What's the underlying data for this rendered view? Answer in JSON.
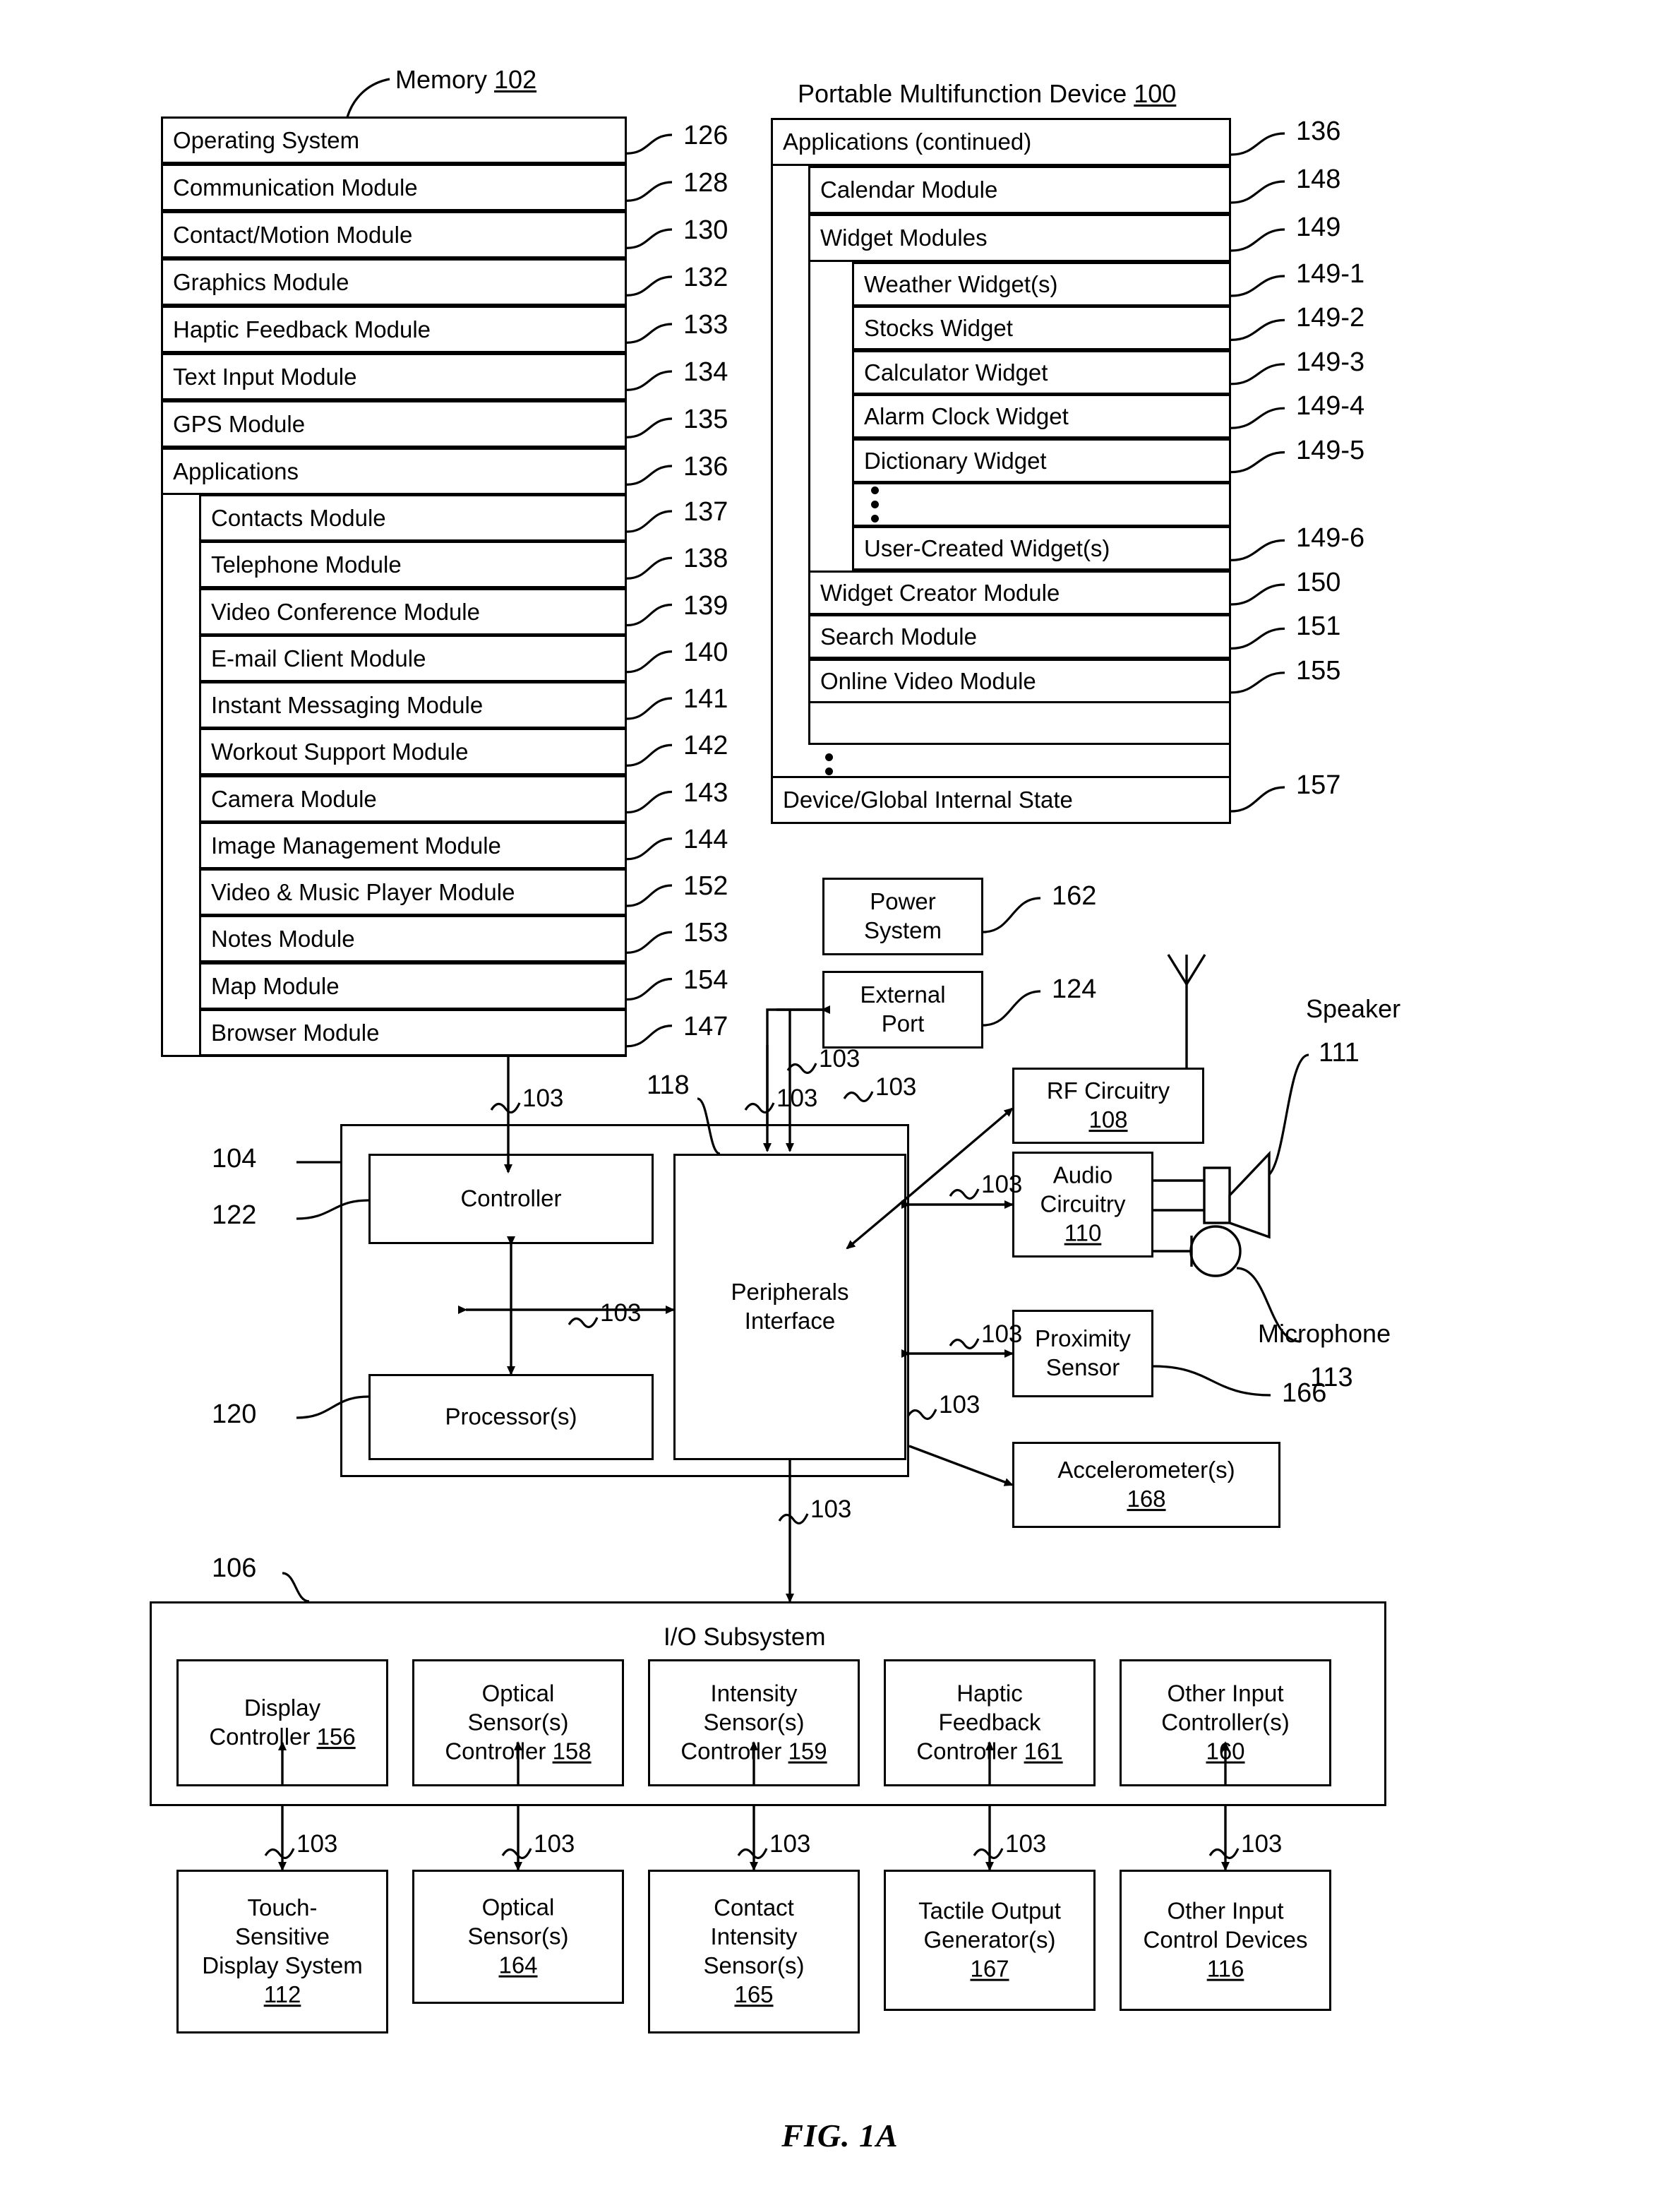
{
  "figure": {
    "caption": "FIG. 1A",
    "memory_title": "Memory",
    "memory_ref": "102",
    "device_title": "Portable Multifunction Device",
    "device_ref": "100"
  },
  "memory_block": {
    "rows": [
      {
        "label": "Operating System",
        "ref": "126"
      },
      {
        "label": "Communication Module",
        "ref": "128"
      },
      {
        "label": "Contact/Motion Module",
        "ref": "130"
      },
      {
        "label": "Graphics Module",
        "ref": "132"
      },
      {
        "label": "Haptic Feedback Module",
        "ref": "133"
      },
      {
        "label": "Text Input Module",
        "ref": "134"
      },
      {
        "label": "GPS Module",
        "ref": "135"
      },
      {
        "label": "Applications",
        "ref": "136"
      }
    ],
    "applications": [
      {
        "label": "Contacts Module",
        "ref": "137"
      },
      {
        "label": "Telephone Module",
        "ref": "138"
      },
      {
        "label": "Video Conference Module",
        "ref": "139"
      },
      {
        "label": "E-mail Client Module",
        "ref": "140"
      },
      {
        "label": "Instant Messaging Module",
        "ref": "141"
      },
      {
        "label": "Workout Support Module",
        "ref": "142"
      },
      {
        "label": "Camera Module",
        "ref": "143"
      },
      {
        "label": "Image Management Module",
        "ref": "144"
      },
      {
        "label": "Video & Music Player Module",
        "ref": "152"
      },
      {
        "label": "Notes Module",
        "ref": "153"
      },
      {
        "label": "Map Module",
        "ref": "154"
      },
      {
        "label": "Browser Module",
        "ref": "147"
      }
    ]
  },
  "device_block": {
    "header": {
      "label": "Applications (continued)",
      "ref": "136"
    },
    "calendar": {
      "label": "Calendar Module",
      "ref": "148"
    },
    "widget_modules": {
      "label": "Widget Modules",
      "ref": "149"
    },
    "widgets": [
      {
        "label": "Weather Widget(s)",
        "ref": "149-1"
      },
      {
        "label": "Stocks Widget",
        "ref": "149-2"
      },
      {
        "label": "Calculator Widget",
        "ref": "149-3"
      },
      {
        "label": "Alarm Clock Widget",
        "ref": "149-4"
      },
      {
        "label": "Dictionary Widget",
        "ref": "149-5"
      },
      {
        "label": "",
        "ref": ""
      },
      {
        "label": "User-Created Widget(s)",
        "ref": "149-6"
      }
    ],
    "tail": [
      {
        "label": "Widget Creator Module",
        "ref": "150"
      },
      {
        "label": "Search Module",
        "ref": "151"
      },
      {
        "label": "Online Video Module",
        "ref": "155"
      }
    ],
    "global_state": {
      "label": "Device/Global Internal State",
      "ref": "157"
    }
  },
  "peripherals": {
    "power_system": {
      "line1": "Power",
      "line2": "System",
      "ref": "162"
    },
    "external_port": {
      "line1": "External",
      "line2": "Port",
      "ref": "124"
    },
    "rf_circuitry": {
      "line1": "RF Circuitry",
      "ref": "108"
    },
    "audio_circuitry": {
      "line1": "Audio",
      "line2": "Circuitry",
      "ref": "110"
    },
    "proximity_sensor": {
      "line1": "Proximity",
      "line2": "Sensor",
      "ref": "166"
    },
    "accelerometers": {
      "line1": "Accelerometer(s)",
      "ref": "168"
    },
    "speaker": {
      "label": "Speaker",
      "ref": "111"
    },
    "microphone": {
      "label": "Microphone",
      "ref": "113"
    }
  },
  "core": {
    "outer_ref": "104",
    "controller": {
      "label": "Controller",
      "ref": "122"
    },
    "processors": {
      "label": "Processor(s)",
      "ref": "120"
    },
    "peripherals_interface": {
      "line1": "Peripherals",
      "line2": "Interface",
      "ref": "118"
    }
  },
  "io_subsystem": {
    "title": "I/O Subsystem",
    "ref": "106",
    "controllers": [
      {
        "line1": "Display",
        "line2": "Controller 156",
        "line3": "",
        "ref": "156"
      },
      {
        "line1": "Optical",
        "line2": "Sensor(s)",
        "line3": "Controller  158",
        "ref": "158"
      },
      {
        "line1": "Intensity",
        "line2": "Sensor(s)",
        "line3": "Controller 159",
        "ref": "159"
      },
      {
        "line1": "Haptic",
        "line2": "Feedback",
        "line3": "Controller 161",
        "ref": "161"
      },
      {
        "line1": "Other Input",
        "line2": "Controller(s)",
        "line3": "160",
        "ref": "160"
      }
    ],
    "devices": [
      {
        "line1": "Touch-",
        "line2": "Sensitive",
        "line3": "Display System",
        "line4": "112"
      },
      {
        "line1": "Optical",
        "line2": "Sensor(s)",
        "line3": "164",
        "line4": ""
      },
      {
        "line1": "Contact",
        "line2": "Intensity",
        "line3": "Sensor(s)",
        "line4": "165"
      },
      {
        "line1": "Tactile Output",
        "line2": "Generator(s)",
        "line3": "167",
        "line4": ""
      },
      {
        "line1": "Other Input",
        "line2": "Control Devices",
        "line3": "116",
        "line4": ""
      }
    ]
  },
  "bus_label": "103",
  "bus_labels_count": 14
}
